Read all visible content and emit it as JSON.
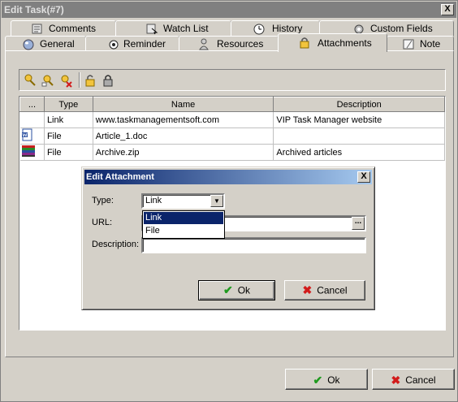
{
  "window": {
    "title": "Edit Task(#7)",
    "close_glyph": "X"
  },
  "tabs_back": [
    {
      "label": "Comments",
      "icon": "comments-icon"
    },
    {
      "label": "Watch List",
      "icon": "watch-list-icon"
    },
    {
      "label": "History",
      "icon": "history-icon"
    },
    {
      "label": "Custom Fields",
      "icon": "custom-fields-icon"
    }
  ],
  "tabs_front": [
    {
      "label": "General",
      "icon": "globe-icon"
    },
    {
      "label": "Reminder",
      "icon": "alarm-icon"
    },
    {
      "label": "Resources",
      "icon": "people-icon"
    },
    {
      "label": "Attachments",
      "icon": "lock-icon",
      "active": true
    },
    {
      "label": "Note",
      "icon": "note-icon"
    }
  ],
  "toolbar": {
    "buttons": [
      "add-attachment-icon",
      "edit-attachment-icon",
      "delete-attachment-icon",
      "open-attachment-icon",
      "save-attachment-icon"
    ]
  },
  "grid": {
    "headers": [
      "...",
      "Type",
      "Name",
      "Description"
    ],
    "rows": [
      {
        "icon": "",
        "type": "Link",
        "name": "www.taskmanagementsoft.com",
        "description": "VIP Task Manager website"
      },
      {
        "icon": "word-document-icon",
        "type": "File",
        "name": "Article_1.doc",
        "description": ""
      },
      {
        "icon": "archive-icon",
        "type": "File",
        "name": "Archive.zip",
        "description": "Archived articles"
      }
    ]
  },
  "edit_dialog": {
    "title": "Edit Attachment",
    "close_glyph": "X",
    "type_label": "Type:",
    "type_value": "Link",
    "type_options": [
      "Link",
      "File"
    ],
    "url_label": "URL:",
    "url_value": "",
    "ellipsis": "...",
    "description_label": "Description:",
    "description_value": "",
    "ok_label": "Ok",
    "cancel_label": "Cancel"
  },
  "footer": {
    "ok_label": "Ok",
    "cancel_label": "Cancel"
  },
  "colors": {
    "accent": "#0a246a",
    "ok_green": "#1f9a1f",
    "cancel_red": "#d21b1b"
  }
}
